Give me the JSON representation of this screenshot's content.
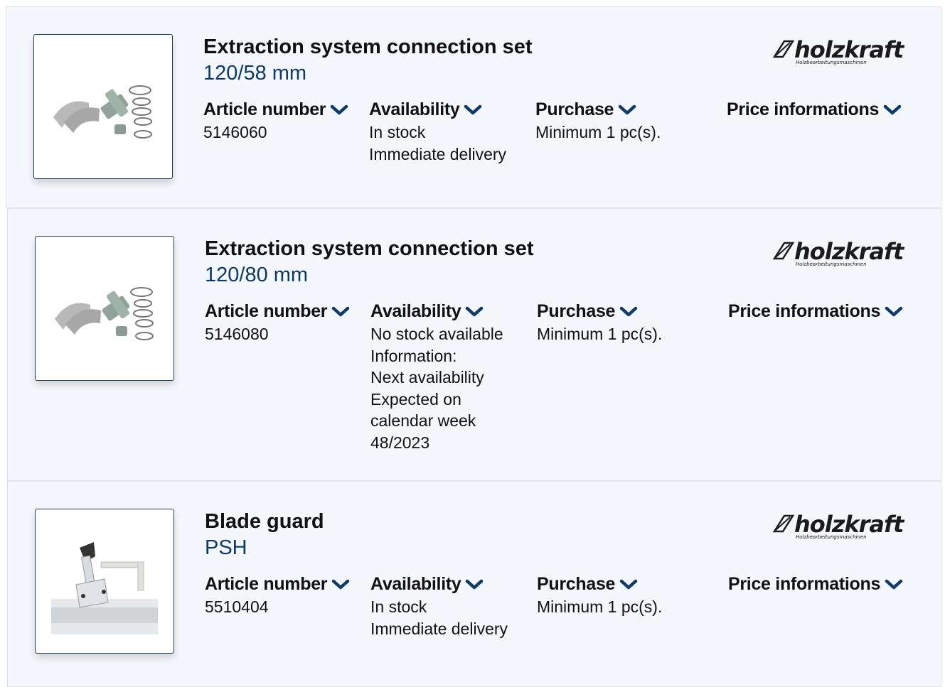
{
  "products": [
    {
      "title": "Extraction system connection set",
      "subtitle": "120/58 mm",
      "article_label": "Article number",
      "article_number": "5146060",
      "availability_label": "Availability",
      "availability_lines": [
        "In stock",
        "Immediate delivery"
      ],
      "purchase_label": "Purchase",
      "purchase_value": "Minimum 1 pc(s).",
      "price_label": "Price informations",
      "brand": "holzkraft",
      "brand_sub": "Holzbearbeitungsmaschinen",
      "image_icon": "connection-set-image"
    },
    {
      "title": "Extraction system connection set",
      "subtitle": "120/80 mm",
      "article_label": "Article number",
      "article_number": "5146080",
      "availability_label": "Availability",
      "availability_lines": [
        "No stock available",
        "Information:",
        "Next availability",
        "Expected on",
        "calendar week",
        "48/2023"
      ],
      "purchase_label": "Purchase",
      "purchase_value": "Minimum 1 pc(s).",
      "price_label": "Price informations",
      "brand": "holzkraft",
      "brand_sub": "Holzbearbeitungsmaschinen",
      "image_icon": "connection-set-image"
    },
    {
      "title": "Blade guard",
      "subtitle": "PSH",
      "article_label": "Article number",
      "article_number": "5510404",
      "availability_label": "Availability",
      "availability_lines": [
        "In stock",
        "Immediate delivery"
      ],
      "purchase_label": "Purchase",
      "purchase_value": "Minimum 1 pc(s).",
      "price_label": "Price informations",
      "brand": "holzkraft",
      "brand_sub": "Holzbearbeitungsmaschinen",
      "image_icon": "blade-guard-image"
    }
  ],
  "colors": {
    "accent": "#0d3a66",
    "card_bg": "#f4f7fb",
    "border": "#dde3ea"
  }
}
